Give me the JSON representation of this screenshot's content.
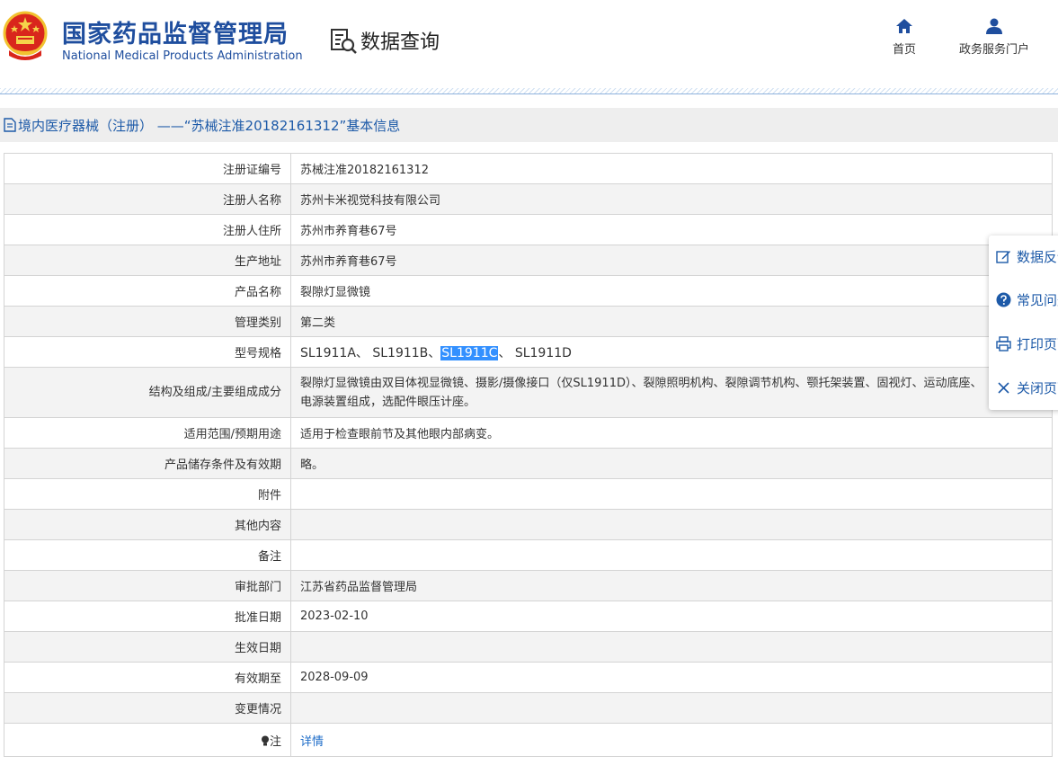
{
  "header": {
    "title_cn": "国家药品监督管理局",
    "title_en": "National Medical Products Administration",
    "query_title": "数据查询",
    "nav": {
      "home": "首页",
      "portal": "政务服务门户"
    }
  },
  "breadcrumb": "境内医疗器械（注册）  ——“苏械注准20182161312”基本信息",
  "rows": [
    {
      "label": "注册证编号",
      "value": "苏械注准20182161312"
    },
    {
      "label": "注册人名称",
      "value": "苏州卡米视觉科技有限公司"
    },
    {
      "label": "注册人住所",
      "value": "苏州市养育巷67号"
    },
    {
      "label": "生产地址",
      "value": "苏州市养育巷67号"
    },
    {
      "label": "产品名称",
      "value": "裂隙灯显微镜"
    },
    {
      "label": "管理类别",
      "value": "第二类"
    },
    {
      "label": "型号规格",
      "models": {
        "a": "SL1911A",
        "sep1": "、 ",
        "b": "SL1911B",
        "sep2": "、",
        "c": "SL1911C",
        "sep3": "、 ",
        "d": "SL1911D"
      }
    },
    {
      "label": "结构及组成/主要组成成分",
      "value_line1": "裂隙灯显微镜由双目体视显微镜、摄影/摄像接口（仅SL1911D）、裂隙照明机构、裂隙调节机构、颚托架装置、固视灯、运动底座、",
      "value_line2": "电源装置组成，选配件眼压计座。"
    },
    {
      "label": "适用范围/预期用途",
      "value": "适用于检查眼前节及其他眼内部病变。"
    },
    {
      "label": "产品储存条件及有效期",
      "value": "略。"
    },
    {
      "label": "附件",
      "value": ""
    },
    {
      "label": "其他内容",
      "value": ""
    },
    {
      "label": "备注",
      "value": ""
    },
    {
      "label": "审批部门",
      "value": "江苏省药品监督管理局"
    },
    {
      "label": "批准日期",
      "value": "2023-02-10"
    },
    {
      "label": "生效日期",
      "value": ""
    },
    {
      "label": "有效期至",
      "value": "2028-09-09"
    },
    {
      "label": "变更情况",
      "value": ""
    },
    {
      "label": "注",
      "value": "详情"
    }
  ],
  "side_panel": [
    "数据反馈",
    "常见问题",
    "打印页面",
    "关闭页面"
  ],
  "colors": {
    "brand_blue": "#1f4e9e",
    "link_blue": "#1d6cc8",
    "selection": "#3390ff"
  }
}
